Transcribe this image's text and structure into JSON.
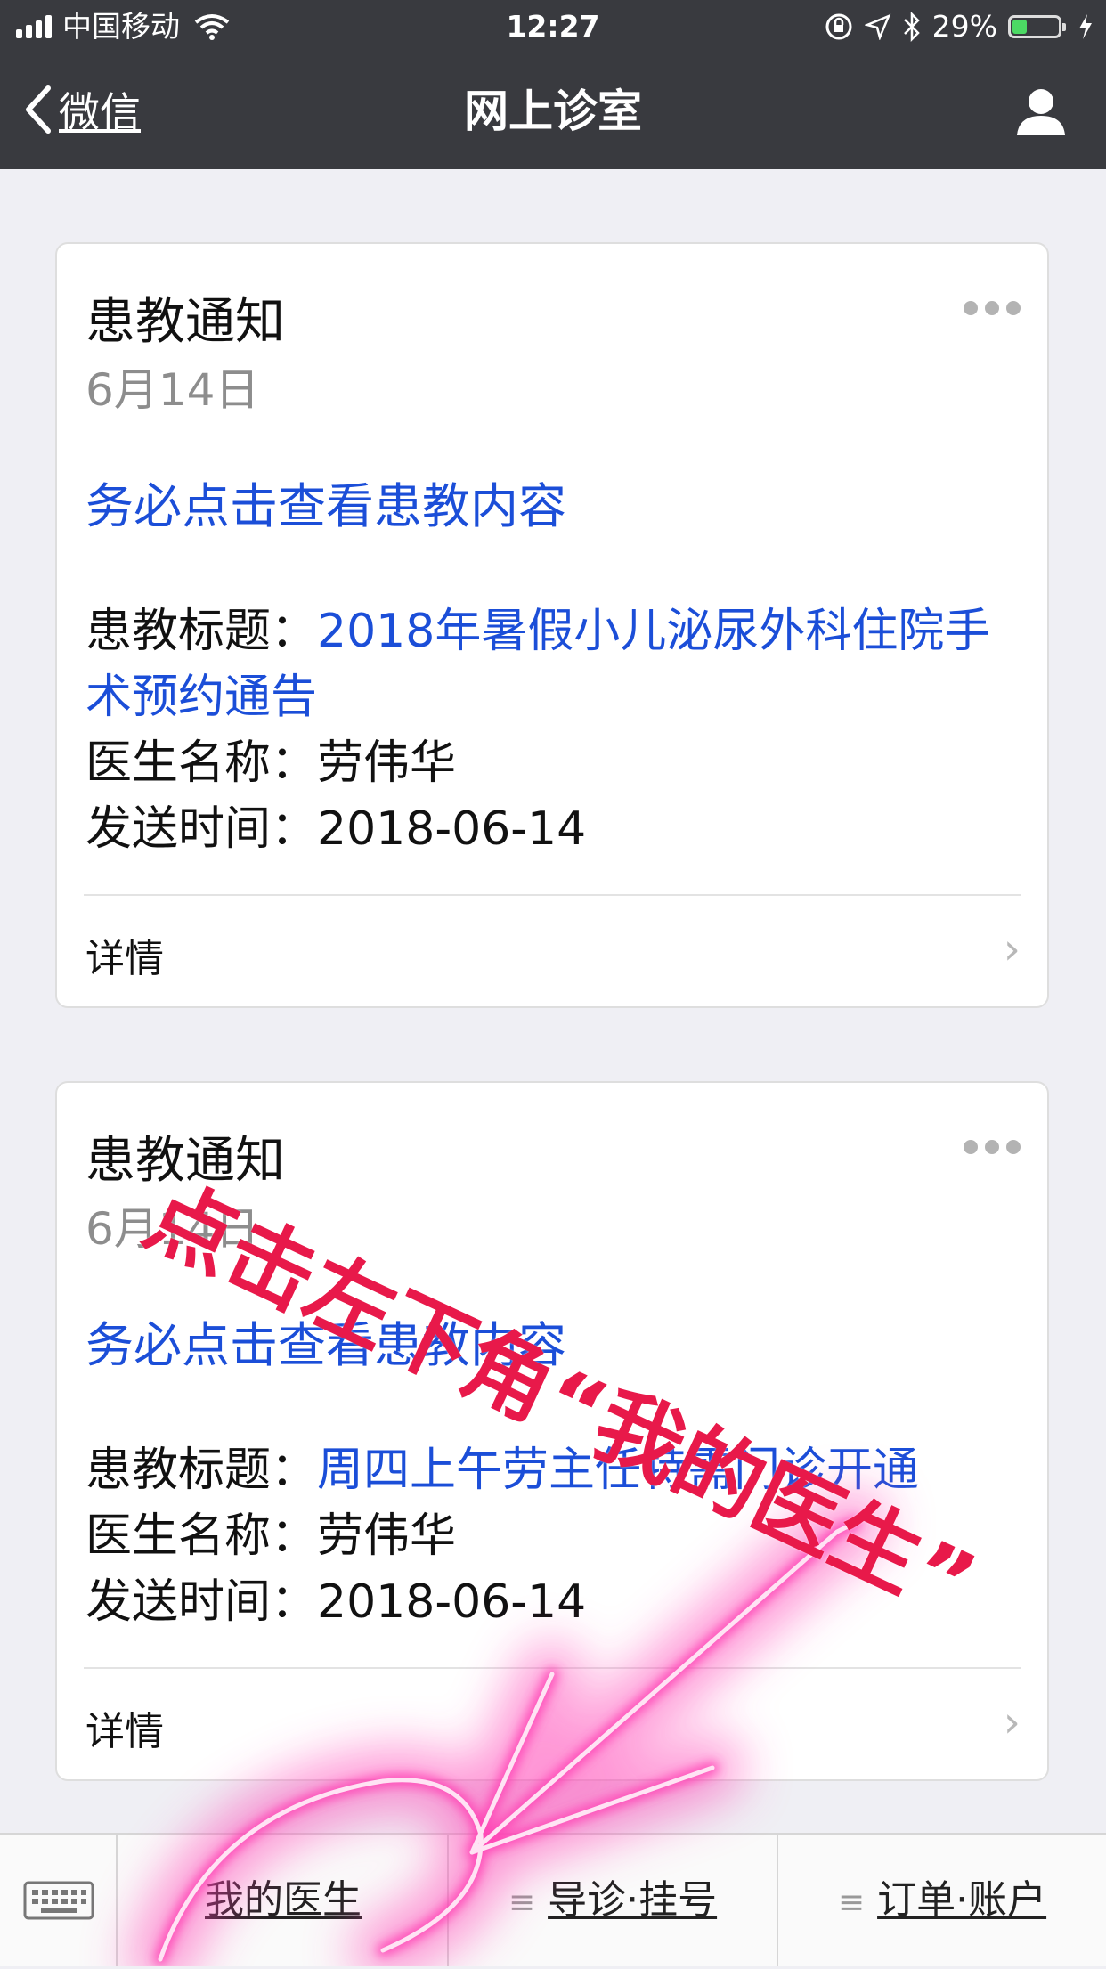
{
  "status_bar": {
    "carrier": "中国移动",
    "time": "12:27",
    "battery_text": "29%",
    "battery_level": 0.29
  },
  "nav": {
    "back_label": "微信",
    "title": "网上诊室"
  },
  "cards": [
    {
      "title": "患教通知",
      "date": "6月14日",
      "link": "务必点击查看患教内容",
      "fields": [
        {
          "label": "患教标题：",
          "value": "2018年暑假小儿泌尿外科住院手术预约通告"
        },
        {
          "label": "医生名称：",
          "value": "劳伟华"
        },
        {
          "label": "发送时间：",
          "value": "2018-06-14"
        }
      ],
      "details_label": "详情"
    },
    {
      "title": "患教通知",
      "date": "6月14日",
      "link": "务必点击查看患教内容",
      "fields": [
        {
          "label": "患教标题：",
          "value": "周四上午劳主任特需门诊开通"
        },
        {
          "label": "医生名称：",
          "value": "劳伟华"
        },
        {
          "label": "发送时间：",
          "value": "2018-06-14"
        }
      ],
      "details_label": "详情"
    }
  ],
  "bottom_menu": {
    "items": [
      "我的医生",
      "导诊·挂号",
      "订单·账户"
    ]
  },
  "annotation": {
    "text": "点击左下角“我的医生”"
  },
  "colors": {
    "nav_bg": "#393a3f",
    "link": "#1b4ed8",
    "annotation": "#e8194a",
    "highlight": "#ff3fb4"
  }
}
